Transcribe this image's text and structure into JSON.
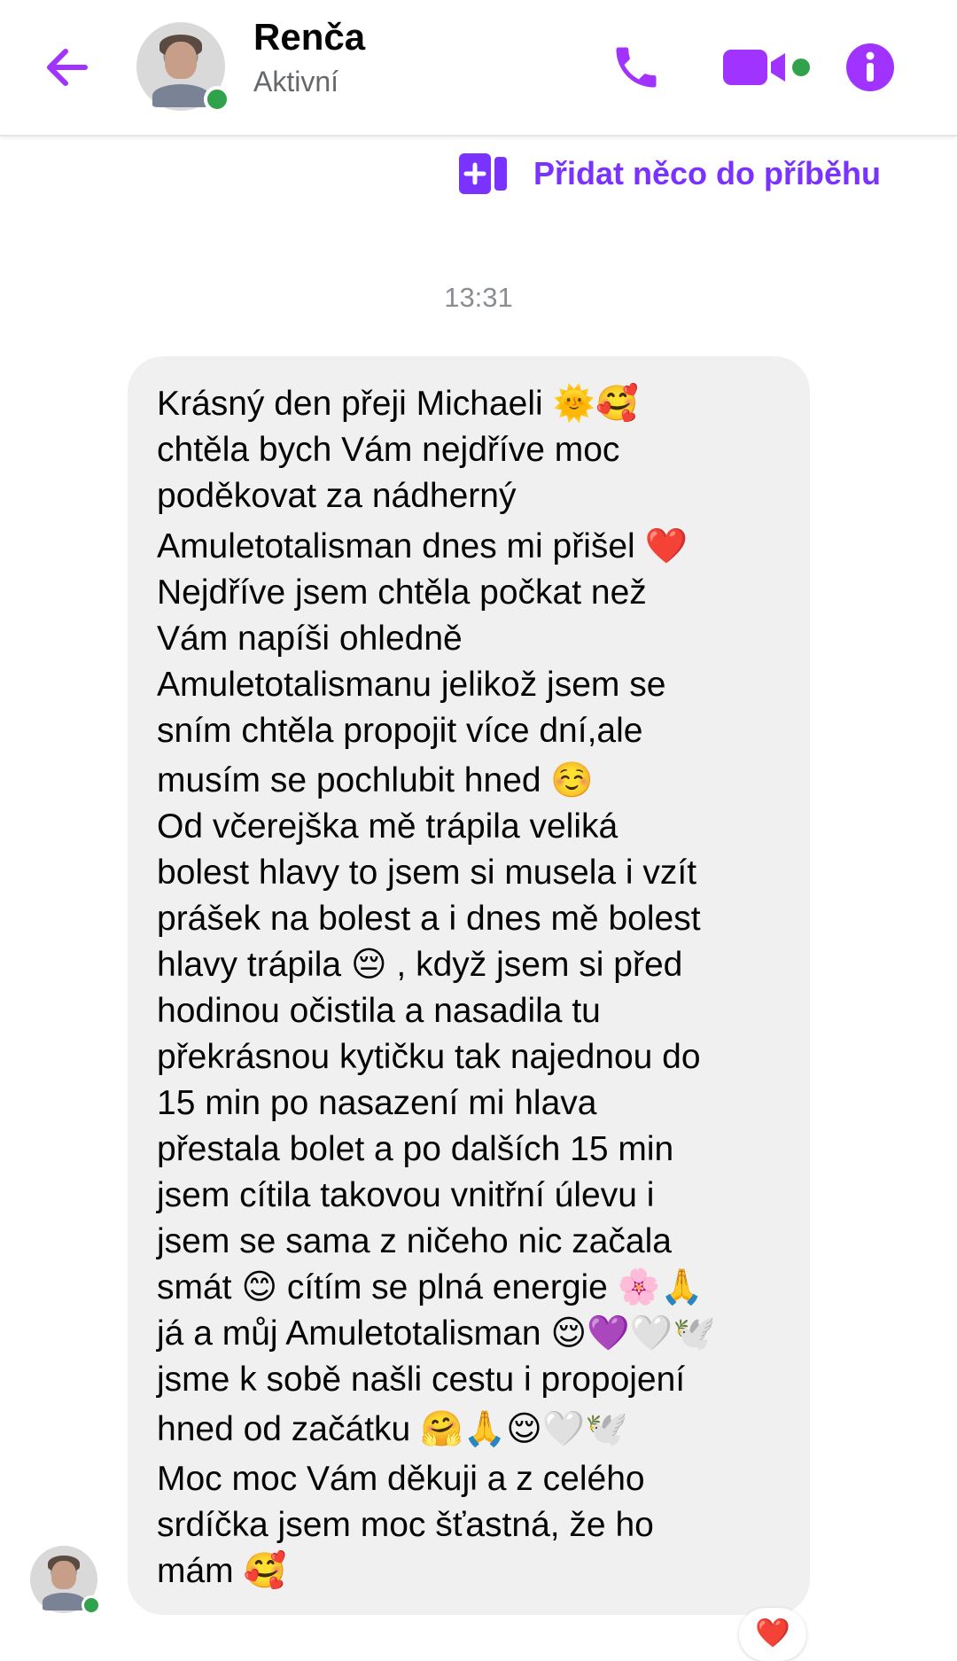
{
  "header": {
    "contact_name": "Renča",
    "contact_status": "Aktivní",
    "icons": {
      "back": "back-arrow-icon",
      "call": "phone-icon",
      "video": "video-camera-icon",
      "info": "info-icon"
    }
  },
  "story": {
    "label": "Přidat něco do příběhu",
    "icon": "add-to-story-icon"
  },
  "timestamp": "13:31",
  "message": {
    "lines": [
      "Krásný den přeji Michaeli 🌞🥰",
      "chtěla bych Vám nejdříve moc",
      "poděkovat za nádherný",
      "Amuletotalisman dnes mi přišel ❤️",
      "Nejdříve jsem chtěla počkat než",
      "Vám napíši ohledně",
      "Amuletotalismanu jelikož jsem se",
      "sním chtěla propojit více dní,ale",
      "musím se pochlubit hned ☺️",
      "Od včerejška mě trápila veliká",
      "bolest hlavy to jsem si musela i vzít",
      "prášek na bolest a i dnes mě bolest",
      "hlavy trápila 😔 , když jsem si před",
      "hodinou očistila a nasadila tu",
      "překrásnou kytičku tak najednou do",
      "15 min po nasazení mi hlava",
      "přestala bolet a po dalších 15 min",
      "jsem cítila takovou vnitřní úlevu i",
      "jsem se sama z ničeho nic začala",
      "smát 😊 cítím se plná energie 🌸🙏",
      "já a můj Amuletotalisman 😌💜🤍🕊️",
      "jsme k sobě našli cestu i propojení",
      "hned od začátku 🤗🙏😌🤍🕊️",
      "Moc moc Vám děkuji a z celého",
      "srdíčka jsem moc šťastná, že ho",
      "mám 🥰"
    ]
  },
  "reaction": "❤️",
  "colors": {
    "accent": "#a033ff",
    "story_text": "#7a32ff",
    "bubble": "#f0f0f0",
    "online": "#31a24c"
  }
}
